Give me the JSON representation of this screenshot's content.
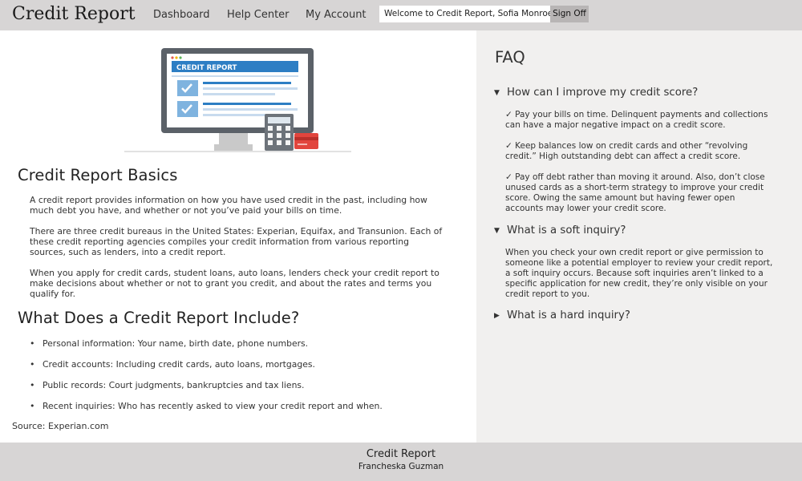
{
  "header": {
    "brand": "Credit Report",
    "nav": [
      "Dashboard",
      "Help Center",
      "My Account"
    ],
    "welcome": "Welcome to Credit Report, Sofia Monroe.",
    "signoff": "Sign Off"
  },
  "hero": {
    "screen_title": "CREDIT REPORT"
  },
  "basics": {
    "heading": "Credit Report Basics",
    "paragraphs": [
      "A credit report provides information on how you have used credit in the past, including how much debt you have, and whether or not you’ve paid your bills on time.",
      "There are three credit bureaus in the United States: Experian, Equifax, and Transunion. Each of these credit reporting agencies compiles your credit information from various reporting sources, such as lenders, into a credit report.",
      "When you apply for credit cards, student loans, auto loans, lenders check your credit report to make decisions about whether or not to grant you credit, and about the rates and terms you qualify for."
    ]
  },
  "include": {
    "heading": "What Does a Credit Report Include?",
    "items": [
      "Personal information: Your name, birth date, phone numbers.",
      "Credit accounts: Including credit cards, auto loans, mortgages.",
      "Public records: Court judgments, bankruptcies and tax liens.",
      "Recent inquiries: Who has recently asked to view your credit report and when."
    ]
  },
  "source": "Source: Experian.com",
  "faq": {
    "title": "FAQ",
    "questions": [
      {
        "question": "How can I improve my credit score?",
        "expanded": true,
        "answers": [
          "✓ Pay your bills on time. Delinquent payments and collections can have a major negative impact on a credit score.",
          "✓ Keep balances low on credit cards and other “revolving credit.” High outstanding debt can affect a credit score.",
          "✓ Pay off debt rather than moving it around. Also, don’t close unused cards as a short-term strategy to improve your credit score. Owing the same amount but having fewer open accounts may lower your credit score."
        ]
      },
      {
        "question": "What is a soft inquiry?",
        "expanded": true,
        "answers": [
          "When you check your own credit report or give permission to someone like a potential employer to review your credit report, a soft inquiry occurs. Because soft inquiries aren’t linked to a specific application for new credit, they’re only visible on your credit report to you."
        ]
      },
      {
        "question": "What is a hard inquiry?",
        "expanded": false,
        "answers": []
      }
    ]
  },
  "footer": {
    "title": "Credit Report",
    "author": "Francheska Guzman"
  }
}
